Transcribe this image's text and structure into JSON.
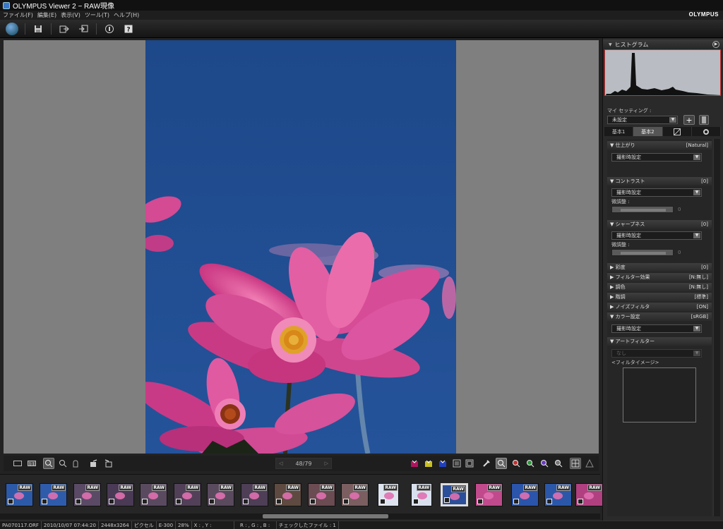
{
  "window": {
    "title": "OLYMPUS Viewer 2 − RAW現像",
    "brand": "OLYMPUS"
  },
  "menu": [
    "ファイル(F)",
    "編集(E)",
    "表示(V)",
    "ツール(T)",
    "ヘルプ(H)"
  ],
  "viewer": {
    "page": "48/79",
    "image": "pink cosmos flowers against blue sky"
  },
  "filmstrip": {
    "badge": "RAW",
    "thumbnails": 16,
    "selected_index": 13
  },
  "right_panel": {
    "histogram_title": "ヒストグラム",
    "my_setting_label": "マイ セッティング :",
    "my_setting_value": "未設定",
    "tabs": [
      "基本1",
      "基本2",
      "",
      ""
    ],
    "sections": {
      "finish": {
        "label": "仕上がり",
        "value": "[Natural]",
        "dropdown": "撮影時設定"
      },
      "contrast": {
        "label": "コントラスト",
        "value": "[0]",
        "dropdown": "撮影時設定",
        "fine": "微調整 :",
        "slider": "0"
      },
      "sharpness": {
        "label": "シャープネス",
        "value": "[0]",
        "dropdown": "撮影時設定",
        "fine": "微調整 :",
        "slider": "0"
      },
      "saturation": {
        "label": "彩度",
        "value": "[0]"
      },
      "filter": {
        "label": "フィルター効果",
        "value": "[N:無し]"
      },
      "tone": {
        "label": "調色",
        "value": "[N:無し]"
      },
      "gradation": {
        "label": "階調",
        "value": "[標準]"
      },
      "noise": {
        "label": "ノイズフィルタ",
        "value": "[ON]"
      },
      "color": {
        "label": "カラー設定",
        "value": "[sRGB]",
        "dropdown": "撮影時設定"
      },
      "art": {
        "label": "アートフィルター",
        "dropdown": "なし",
        "image_label": "<フィルタイメージ>"
      }
    }
  },
  "status": {
    "file": "PA070117.ORF",
    "datetime": "2010/10/07 07:44:20",
    "size": "2448x3264",
    "unit": "ピクセル",
    "camera": "E-300",
    "zoom": "28%",
    "xy": "X : , Y :",
    "rgb": "R : , G : , B :",
    "checked": "チェックしたファイル : 1"
  }
}
